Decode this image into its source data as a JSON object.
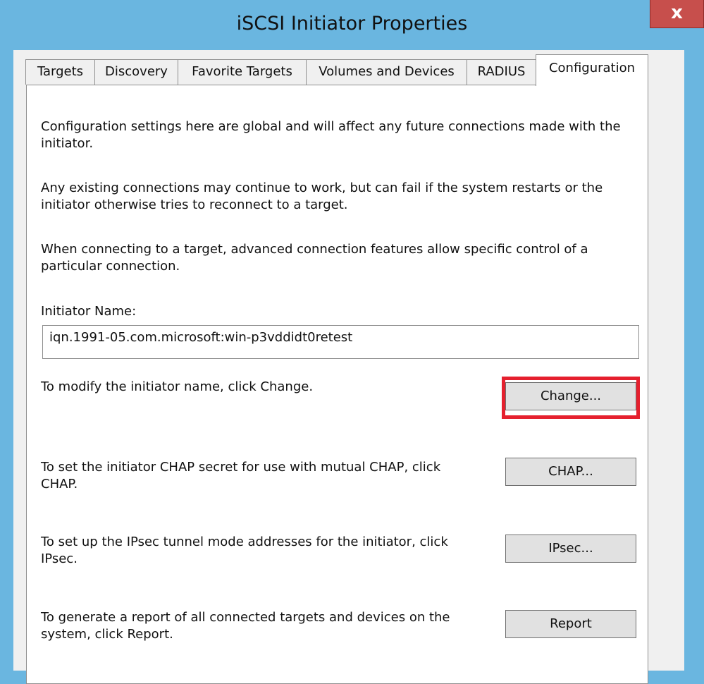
{
  "window": {
    "title": "iSCSI Initiator Properties",
    "close_label": "x",
    "accent": "#6ab6e0",
    "close_color": "#c74f4c"
  },
  "tabs": [
    {
      "label": "Targets"
    },
    {
      "label": "Discovery"
    },
    {
      "label": "Favorite Targets"
    },
    {
      "label": "Volumes and Devices"
    },
    {
      "label": "RADIUS"
    },
    {
      "label": "Configuration",
      "active": true
    }
  ],
  "config": {
    "para1": "Configuration settings here are global and will affect any future connections made with the initiator.",
    "para2": "Any existing connections may continue to work, but can fail if the system restarts or the initiator otherwise tries to reconnect to a target.",
    "para3": "When connecting to a target, advanced connection features allow specific control of a particular connection.",
    "initiator_name_label": "Initiator Name:",
    "initiator_name_value": "iqn.1991-05.com.microsoft:win-p3vddidt0retest",
    "change_text": "To modify the initiator name, click Change.",
    "change_button": "Change...",
    "chap_text": "To set the initiator CHAP secret for use with mutual CHAP, click CHAP.",
    "chap_button": "CHAP...",
    "ipsec_text": "To set up the IPsec tunnel mode addresses for the initiator, click IPsec.",
    "ipsec_button": "IPsec...",
    "report_text": "To generate a report of all connected targets and devices on the system, click Report.",
    "report_button": "Report",
    "highlight_color": "#e5202e"
  }
}
